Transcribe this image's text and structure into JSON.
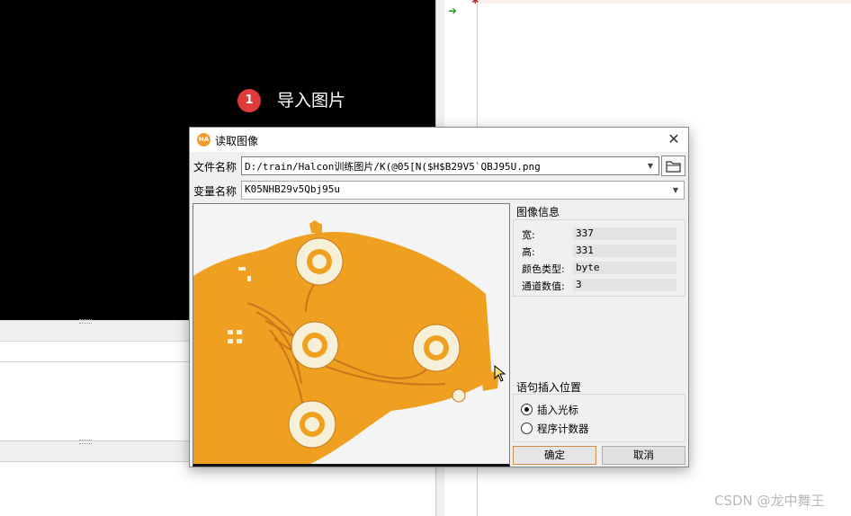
{
  "annotation": {
    "step_number": "1",
    "step_label": "导入图片"
  },
  "watermark": "CSDN @龙中舞王",
  "dialog": {
    "title": "读取图像",
    "app_icon_text": "HA",
    "close_label": "✕",
    "file_name_label": "文件名称",
    "file_name_value": "D:/train/Halcon训练图片/K(@05[N($H$B29V5`QBJ95U.png",
    "variable_name_label": "变量名称",
    "variable_name_value": "K05NHB29v5Qbj95u",
    "image_info": {
      "title": "图像信息",
      "rows": [
        {
          "key": "宽:",
          "value": "337"
        },
        {
          "key": "高:",
          "value": "331"
        },
        {
          "key": "颜色类型:",
          "value": "byte"
        },
        {
          "key": "通道数值:",
          "value": "3"
        }
      ]
    },
    "insert_position": {
      "title": "语句插入位置",
      "options": [
        {
          "label": "插入光标",
          "selected": true
        },
        {
          "label": "程序计数器",
          "selected": false
        }
      ]
    },
    "ok_label": "确定",
    "cancel_label": "取消"
  },
  "colors": {
    "badge": "#e03a3a",
    "pcb": "#f0a020",
    "graphics_bg": "#000000"
  },
  "icons": [
    "app-icon",
    "close-icon",
    "dropdown-arrow-icon",
    "folder-icon",
    "arrow-icon",
    "mouse-cursor-icon"
  ]
}
